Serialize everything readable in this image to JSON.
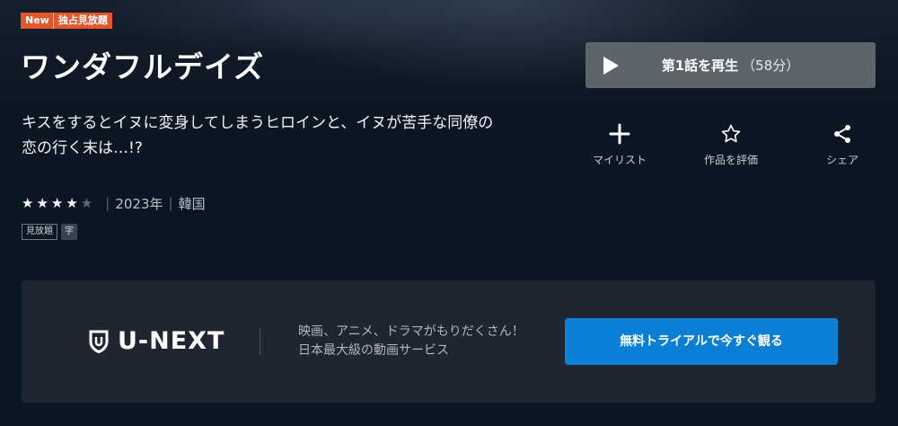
{
  "badges": {
    "new": "New",
    "exclusive": "独占見放題"
  },
  "title": "ワンダフルデイズ",
  "description": "キスをするとイヌに変身してしまうヒロインと、イヌが苦手な同僚の恋の行く末は…!?",
  "rating": {
    "value": 4,
    "max": 5
  },
  "meta": {
    "year": "2023年",
    "country": "韓国"
  },
  "tags": [
    "見放題",
    "字"
  ],
  "play": {
    "label": "第1話を再生",
    "duration": "（58分）"
  },
  "actions": [
    {
      "label": "マイリスト",
      "icon": "plus-icon"
    },
    {
      "label": "作品を評価",
      "icon": "star-outline-icon"
    },
    {
      "label": "シェア",
      "icon": "share-icon"
    }
  ],
  "promo": {
    "logo": "U-NEXT",
    "line1": "映画、アニメ、ドラマがもりだくさん！",
    "line2": "日本最大級の動画サービス",
    "cta": "無料トライアルで今すぐ観る"
  },
  "colors": {
    "badge": "#e3572a",
    "cta": "#0b7fd6",
    "background": "#0b1623"
  }
}
